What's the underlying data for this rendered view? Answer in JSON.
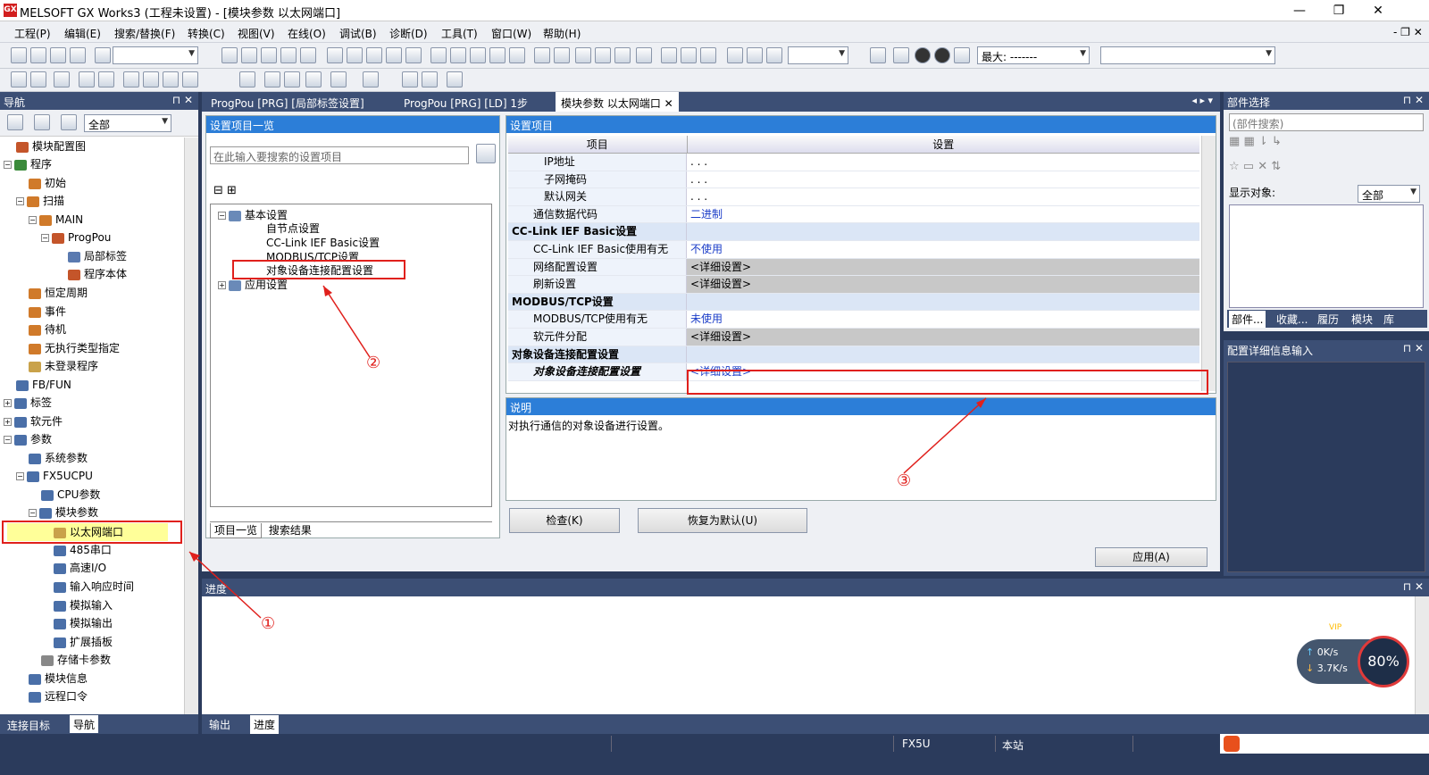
{
  "window": {
    "title": "MELSOFT GX Works3 (工程未设置) - [模块参数 以太网端口]",
    "app_icon": "GX",
    "min": "—",
    "restore": "❐",
    "close": "✕"
  },
  "menu": [
    "工程(P)",
    "编辑(E)",
    "搜索/替换(F)",
    "转换(C)",
    "视图(V)",
    "在线(O)",
    "调试(B)",
    "诊断(D)",
    "工具(T)",
    "窗口(W)",
    "帮助(H)"
  ],
  "toolbar": {
    "max_label": "最大: -------"
  },
  "nav": {
    "title": "导航",
    "filter": "全部",
    "items": [
      {
        "label": "模块配置图"
      },
      {
        "label": "程序"
      },
      {
        "label": "初始"
      },
      {
        "label": "扫描"
      },
      {
        "label": "MAIN"
      },
      {
        "label": "ProgPou"
      },
      {
        "label": "局部标签"
      },
      {
        "label": "程序本体"
      },
      {
        "label": "恒定周期"
      },
      {
        "label": "事件"
      },
      {
        "label": "待机"
      },
      {
        "label": "无执行类型指定"
      },
      {
        "label": "未登录程序"
      },
      {
        "label": "FB/FUN"
      },
      {
        "label": "标签"
      },
      {
        "label": "软元件"
      },
      {
        "label": "参数"
      },
      {
        "label": "系统参数"
      },
      {
        "label": "FX5UCPU"
      },
      {
        "label": "CPU参数"
      },
      {
        "label": "模块参数"
      },
      {
        "label": "以太网端口"
      },
      {
        "label": "485串口"
      },
      {
        "label": "高速I/O"
      },
      {
        "label": "输入响应时间"
      },
      {
        "label": "模拟输入"
      },
      {
        "label": "模拟输出"
      },
      {
        "label": "扩展插板"
      },
      {
        "label": "存储卡参数"
      },
      {
        "label": "模块信息"
      },
      {
        "label": "远程口令"
      }
    ],
    "bottom_tabs": [
      "连接目标",
      "导航"
    ]
  },
  "tabs": [
    "ProgPou [PRG] [局部标签设置]",
    "ProgPou [PRG] [LD] 1步",
    "模块参数 以太网端口"
  ],
  "settings_list": {
    "title": "设置项目一览",
    "search_placeholder": "在此输入要搜索的设置项目",
    "tree": [
      "基本设置",
      "自节点设置",
      "CC-Link IEF Basic设置",
      "MODBUS/TCP设置",
      "对象设备连接配置设置",
      "应用设置"
    ],
    "bottom_tabs": [
      "项目一览",
      "搜索结果"
    ]
  },
  "settings": {
    "title": "设置项目",
    "col_item": "项目",
    "col_setting": "设置",
    "rows": [
      {
        "item": "IP地址",
        "value": ".  .  ."
      },
      {
        "item": "子网掩码",
        "value": ".  .  ."
      },
      {
        "item": "默认网关",
        "value": ".  .  ."
      },
      {
        "item": "通信数据代码",
        "value": "二进制"
      },
      {
        "item": "CC-Link IEF Basic设置",
        "value": ""
      },
      {
        "item": "CC-Link IEF Basic使用有无",
        "value": "不使用"
      },
      {
        "item": "网络配置设置",
        "value": "<详细设置>"
      },
      {
        "item": "刷新设置",
        "value": "<详细设置>"
      },
      {
        "item": "MODBUS/TCP设置",
        "value": ""
      },
      {
        "item": "MODBUS/TCP使用有无",
        "value": "未使用"
      },
      {
        "item": "软元件分配",
        "value": "<详细设置>"
      },
      {
        "item": "对象设备连接配置设置",
        "value": ""
      },
      {
        "item": "对象设备连接配置设置",
        "value": "<详细设置>"
      }
    ]
  },
  "description": {
    "title": "说明",
    "text": "对执行通信的对象设备进行设置。"
  },
  "buttons": {
    "check": "检查(K)",
    "restore": "恢复为默认(U)",
    "apply": "应用(A)"
  },
  "parts": {
    "title": "部件选择",
    "search": "(部件搜索)",
    "display_label": "显示对象:",
    "display_value": "全部",
    "tabs": [
      "部件...",
      "收藏...",
      "履历",
      "模块",
      "库"
    ]
  },
  "detail": {
    "title": "配置详细信息输入"
  },
  "progress": {
    "title": "进度",
    "tabs": [
      "输出",
      "进度"
    ],
    "speed_up": "0K/s",
    "speed_down": "3.7K/s",
    "percent": "80%",
    "vip": "VIP"
  },
  "status": {
    "cpu": "FX5U",
    "station": "本站"
  },
  "annotations": {
    "a1": "①",
    "a2": "②",
    "a3": "③"
  },
  "colors": {
    "nav_header": "#3c4f75",
    "blue_header": "#2c7ed8",
    "highlight": "#ffff99",
    "annotation": "#e0201c"
  }
}
